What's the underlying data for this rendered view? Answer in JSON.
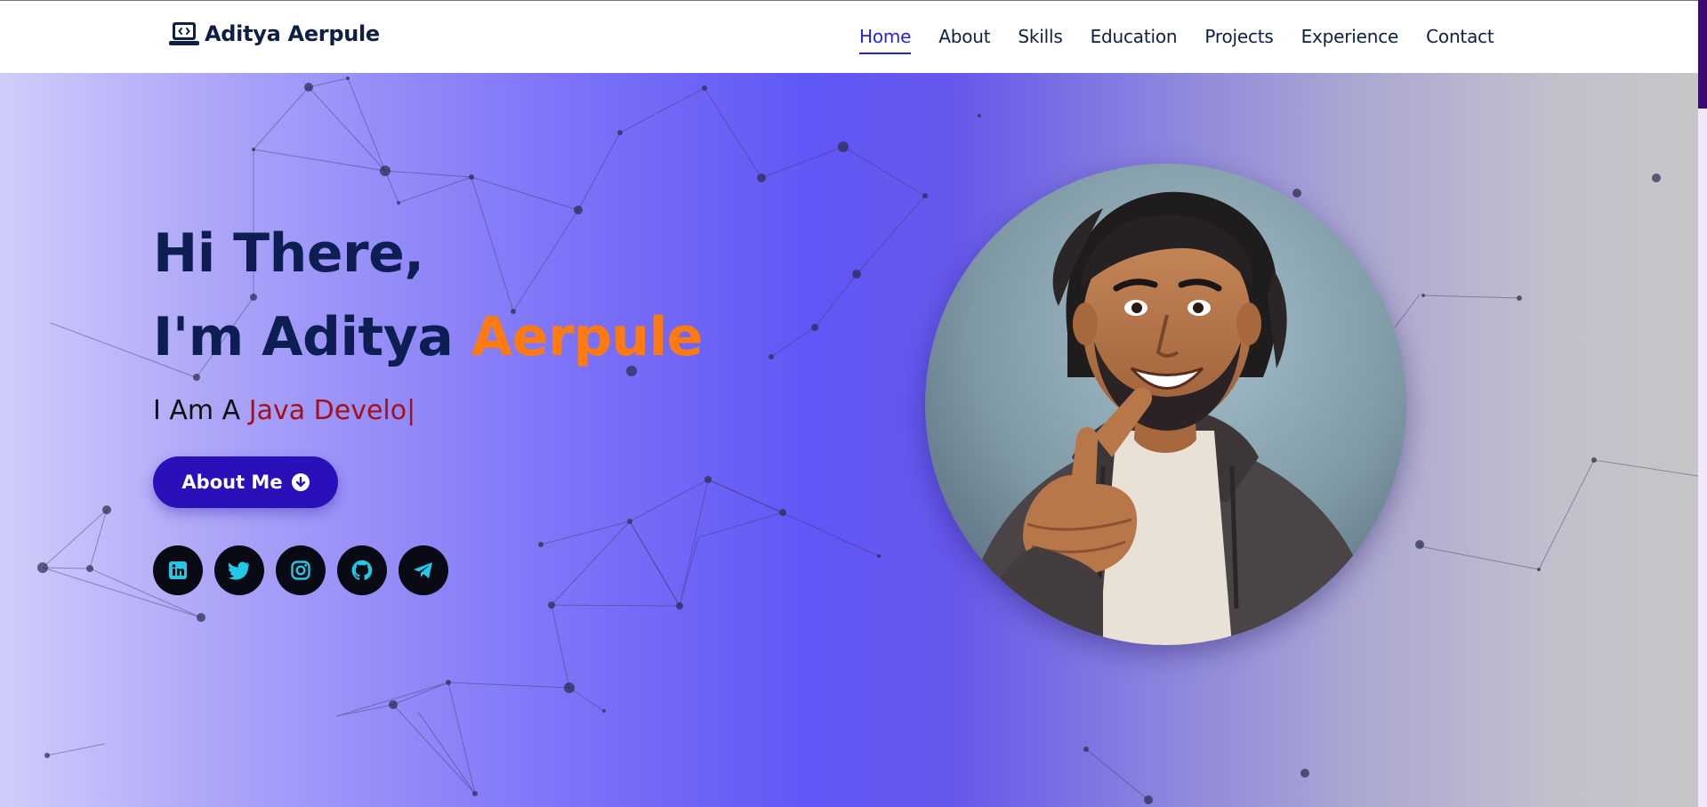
{
  "brand": {
    "name": "Aditya Aerpule",
    "icon": "laptop-code-icon"
  },
  "nav": {
    "items": [
      {
        "label": "Home",
        "active": true
      },
      {
        "label": "About"
      },
      {
        "label": "Skills"
      },
      {
        "label": "Education"
      },
      {
        "label": "Projects"
      },
      {
        "label": "Experience"
      },
      {
        "label": "Contact"
      }
    ]
  },
  "hero": {
    "greeting": "Hi There,",
    "intro_prefix": "I'm Aditya ",
    "intro_highlight": "Aerpule",
    "role_prefix": "I Am A ",
    "role_typed": "Java Develo",
    "caret": "|",
    "about_button": "About Me",
    "about_icon": "arrow-circle-down-icon"
  },
  "socials": [
    {
      "icon": "linkedin-icon"
    },
    {
      "icon": "twitter-icon"
    },
    {
      "icon": "instagram-icon"
    },
    {
      "icon": "github-icon"
    },
    {
      "icon": "telegram-icon"
    }
  ],
  "colors": {
    "heading": "#0c1e52",
    "accent_orange": "#ff7a0f",
    "role_red": "#a4101c",
    "button": "#2a10b8",
    "nav_active": "#2424e0",
    "social_icon": "#22c8e8"
  }
}
